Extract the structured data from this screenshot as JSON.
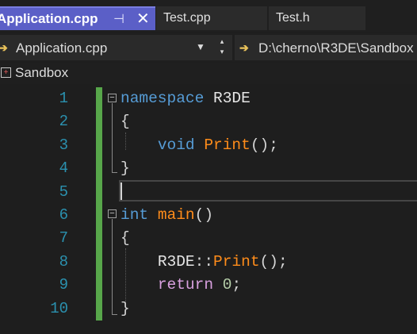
{
  "tabs": [
    {
      "label": "Application.cpp",
      "active": true,
      "pin_glyph": "⊣",
      "close_glyph": "✕"
    },
    {
      "label": "Test.cpp",
      "active": false
    },
    {
      "label": "Test.h",
      "active": false
    }
  ],
  "navbar": {
    "file_scope": "Application.cpp",
    "path": "D:\\cherno\\R3DE\\Sandbox",
    "arrow_glyph": "➔",
    "dropdown_glyph": "▼",
    "spin_up": "▴",
    "spin_down": "▾"
  },
  "project": {
    "name": "Sandbox",
    "icon": "project-icon"
  },
  "editor": {
    "line_numbers": [
      "1",
      "2",
      "3",
      "4",
      "5",
      "6",
      "7",
      "8",
      "9",
      "10"
    ],
    "lines": [
      [
        {
          "t": "namespace",
          "c": "kw"
        },
        {
          "t": " ",
          "c": "pn"
        },
        {
          "t": "R3DE",
          "c": "ns"
        }
      ],
      [
        {
          "t": "{",
          "c": "pn"
        }
      ],
      [
        {
          "t": "    ",
          "c": "pn"
        },
        {
          "t": "void",
          "c": "kw"
        },
        {
          "t": " ",
          "c": "pn"
        },
        {
          "t": "Print",
          "c": "fn"
        },
        {
          "t": "();",
          "c": "pn"
        }
      ],
      [
        {
          "t": "}",
          "c": "pn"
        }
      ],
      [],
      [
        {
          "t": "int",
          "c": "kw"
        },
        {
          "t": " ",
          "c": "pn"
        },
        {
          "t": "main",
          "c": "fn"
        },
        {
          "t": "()",
          "c": "pn"
        }
      ],
      [
        {
          "t": "{",
          "c": "pn"
        }
      ],
      [
        {
          "t": "    ",
          "c": "pn"
        },
        {
          "t": "R3DE",
          "c": "ns"
        },
        {
          "t": "::",
          "c": "pn"
        },
        {
          "t": "Print",
          "c": "fn"
        },
        {
          "t": "();",
          "c": "pn"
        }
      ],
      [
        {
          "t": "    ",
          "c": "pn"
        },
        {
          "t": "return",
          "c": "ctl"
        },
        {
          "t": " ",
          "c": "pn"
        },
        {
          "t": "0",
          "c": "num"
        },
        {
          "t": ";",
          "c": "pn"
        }
      ],
      [
        {
          "t": "}",
          "c": "pn"
        }
      ]
    ],
    "fold_glyph": "−",
    "colors": {
      "keyword": "#569cd6",
      "function": "#ff8c1a",
      "control": "#d8a0df",
      "number": "#b5cea8",
      "line_number": "#2b91af",
      "change_bar": "#57a64a",
      "active_tab": "#5b5fc7"
    }
  }
}
